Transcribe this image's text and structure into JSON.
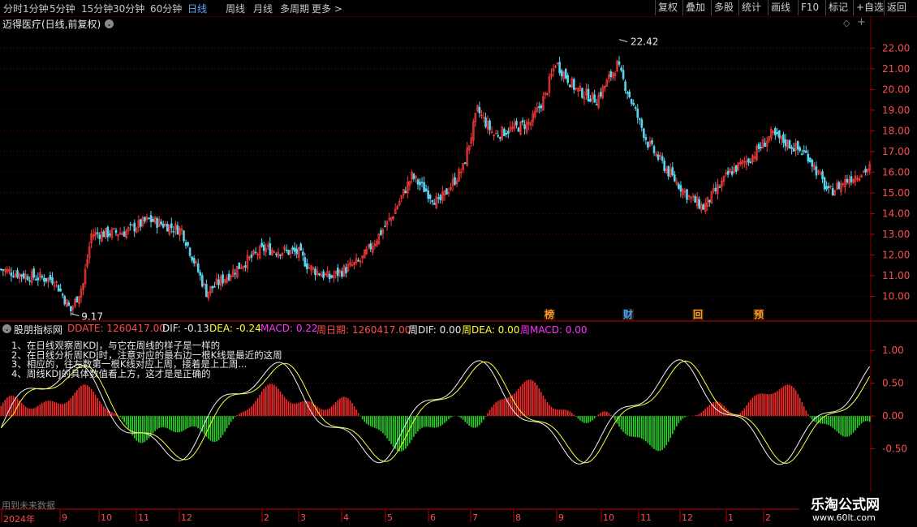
{
  "toolbar": {
    "periods": [
      "分时",
      "1分钟",
      "5分钟",
      "15分钟",
      "30分钟",
      "60分钟",
      "日线",
      "周线",
      "月线",
      "多周期",
      "更多 >"
    ],
    "active_period": "日线",
    "buttons": [
      "复权",
      "叠加",
      "多股",
      "统计",
      "画线",
      "F10",
      "标记",
      "+自选",
      "返回"
    ]
  },
  "main_chart": {
    "title": "迈得医疗(日线,前复权)",
    "y_ticks": [
      "22.00",
      "21.00",
      "20.00",
      "19.00",
      "18.00",
      "17.00",
      "16.00",
      "15.00",
      "14.00",
      "13.00",
      "12.00",
      "11.00",
      "10.00"
    ],
    "high_label": "22.42",
    "low_label": "9.17",
    "events": [
      {
        "label": "榜",
        "color": "#ff9a2e"
      },
      {
        "label": "财",
        "color": "#4aa3ff"
      },
      {
        "label": "回",
        "color": "#ff9a2e"
      },
      {
        "label": "预",
        "color": "#ff9a2e"
      }
    ]
  },
  "indicator": {
    "name": "股朋指标网",
    "values": [
      {
        "text": "DDATE: 1260417.00",
        "color": "#ff4d4d"
      },
      {
        "text": "DIF: -0.13",
        "color": "#e8e8e8"
      },
      {
        "text": "DEA: -0.24",
        "color": "#ffff33"
      },
      {
        "text": "MACD: 0.22",
        "color": "#ff33ff"
      },
      {
        "text": "周日期: 1260417.00",
        "color": "#ff4d4d"
      },
      {
        "text": "周DIF: 0.00",
        "color": "#e8e8e8"
      },
      {
        "text": "周DEA: 0.00",
        "color": "#ffff33"
      },
      {
        "text": "周MACD: 0.00",
        "color": "#ff33ff"
      }
    ],
    "notes": [
      "1、在日线观察周KDJ，与它在周线的样子是一样的",
      "2、在日线分析周KDJ时，注意对应的最右边一根K线是最近的这周",
      "3、相应的，往左数第一根K线对应上周，接着是上上周...",
      "4、周线KDJ的具体数值看上方，这才是是正确的"
    ],
    "y_ticks": [
      "1.00",
      "0.50",
      "0.00",
      "-0.50"
    ]
  },
  "time_axis": {
    "labels": [
      "2024年",
      "9",
      "10",
      "11",
      "12",
      "2",
      "3",
      "4",
      "5",
      "6",
      "7",
      "8",
      "9",
      "10",
      "11",
      "12",
      "1",
      "2"
    ],
    "future_text": "用到未来数据"
  },
  "watermark": {
    "line1": "乐淘公式网",
    "line2": "www.60lt.com"
  },
  "colors": {
    "up": "#ff3b3b",
    "down": "#5ad6f0",
    "macd_up": "#ff2a2a",
    "macd_down": "#2ad42a",
    "grid": "#7a0000"
  },
  "chart_data": {
    "type": "candlestick",
    "title": "迈得医疗(日线,前复权)",
    "ylim": [
      9.0,
      22.6
    ],
    "anchors": [
      [
        0,
        11.3
      ],
      [
        12,
        11.0
      ],
      [
        26,
        10.8
      ],
      [
        34,
        9.3
      ],
      [
        40,
        10.6
      ],
      [
        44,
        13.0
      ],
      [
        60,
        13.1
      ],
      [
        72,
        13.7
      ],
      [
        88,
        13.2
      ],
      [
        100,
        10.2
      ],
      [
        118,
        11.6
      ],
      [
        128,
        12.3
      ],
      [
        145,
        12.1
      ],
      [
        150,
        11.4
      ],
      [
        160,
        10.9
      ],
      [
        175,
        11.7
      ],
      [
        190,
        13.8
      ],
      [
        200,
        15.8
      ],
      [
        213,
        14.5
      ],
      [
        225,
        16.2
      ],
      [
        232,
        19.0
      ],
      [
        240,
        17.8
      ],
      [
        258,
        18.4
      ],
      [
        265,
        19.7
      ],
      [
        270,
        21.3
      ],
      [
        280,
        20.0
      ],
      [
        290,
        19.5
      ],
      [
        300,
        21.2
      ],
      [
        315,
        17.4
      ],
      [
        325,
        16.0
      ],
      [
        335,
        14.8
      ],
      [
        342,
        14.3
      ],
      [
        355,
        16.0
      ],
      [
        365,
        16.7
      ],
      [
        375,
        17.8
      ],
      [
        383,
        17.4
      ],
      [
        393,
        16.8
      ],
      [
        403,
        15.0
      ],
      [
        413,
        15.7
      ],
      [
        423,
        16.2
      ]
    ],
    "high_point": {
      "value": 22.42
    },
    "low_point": {
      "value": 9.17
    },
    "indicator_ylim": [
      -1.05,
      1.25
    ],
    "indicator_y_ticks": [
      1.0,
      0.5,
      0.0,
      -0.5
    ]
  }
}
